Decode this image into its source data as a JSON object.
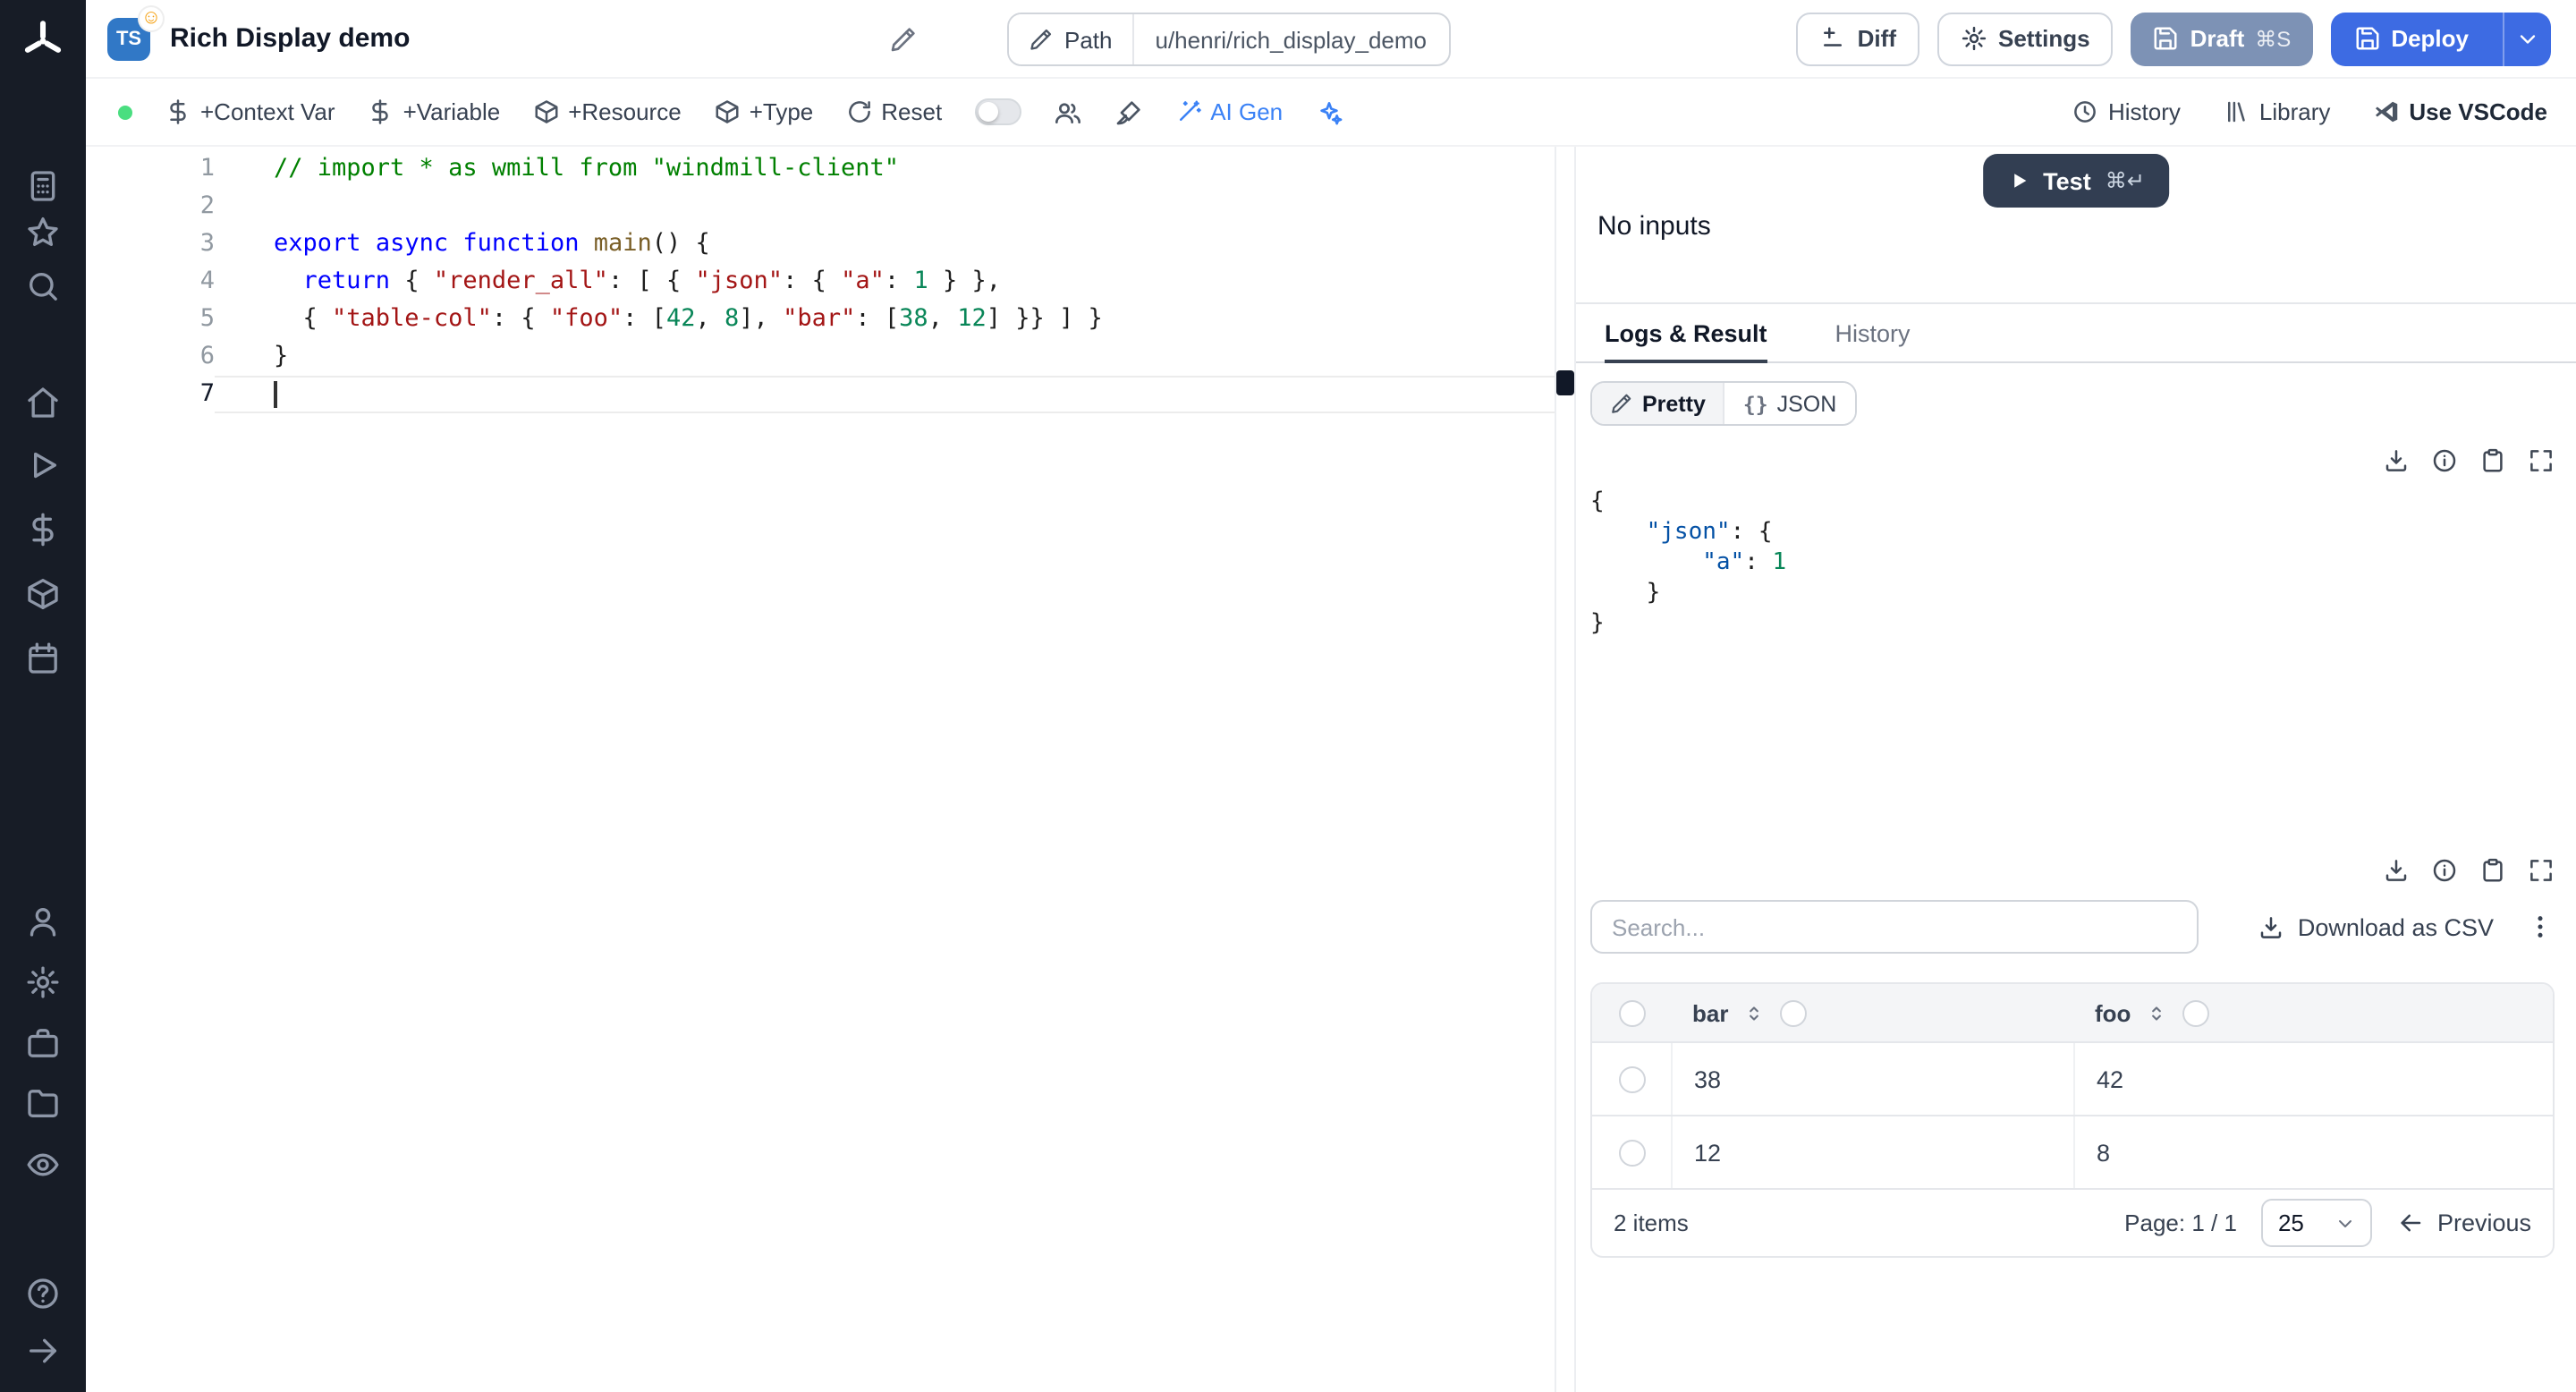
{
  "topbar": {
    "lang_badge": "TS",
    "title": "Rich Display demo",
    "path_label": "Path",
    "path_value": "u/henri/rich_display_demo",
    "diff": "Diff",
    "settings": "Settings",
    "draft": "Draft",
    "draft_kbd": "⌘S",
    "deploy": "Deploy"
  },
  "toolbar": {
    "context_var": "+Context Var",
    "variable": "+Variable",
    "resource": "+Resource",
    "type": "+Type",
    "reset": "Reset",
    "ai_gen": "AI Gen",
    "history": "History",
    "library": "Library",
    "vscode": "Use VSCode"
  },
  "editor": {
    "cursor_line": 7,
    "lines": [
      {
        "n": 1,
        "segs": [
          {
            "c": "comment",
            "t": "// import * as wmill from \"windmill-client\""
          }
        ]
      },
      {
        "n": 2,
        "segs": []
      },
      {
        "n": 3,
        "segs": [
          {
            "c": "kw",
            "t": "export"
          },
          {
            "c": "plain",
            "t": " "
          },
          {
            "c": "kw",
            "t": "async"
          },
          {
            "c": "plain",
            "t": " "
          },
          {
            "c": "kw",
            "t": "function"
          },
          {
            "c": "plain",
            "t": " "
          },
          {
            "c": "fn",
            "t": "main"
          },
          {
            "c": "plain",
            "t": "() {"
          }
        ]
      },
      {
        "n": 4,
        "segs": [
          {
            "c": "plain",
            "t": "  "
          },
          {
            "c": "kw",
            "t": "return"
          },
          {
            "c": "plain",
            "t": " { "
          },
          {
            "c": "str",
            "t": "\"render_all\""
          },
          {
            "c": "plain",
            "t": ": [ { "
          },
          {
            "c": "str",
            "t": "\"json\""
          },
          {
            "c": "plain",
            "t": ": { "
          },
          {
            "c": "str",
            "t": "\"a\""
          },
          {
            "c": "plain",
            "t": ": "
          },
          {
            "c": "num",
            "t": "1"
          },
          {
            "c": "plain",
            "t": " } },"
          }
        ]
      },
      {
        "n": 5,
        "segs": [
          {
            "c": "plain",
            "t": "  { "
          },
          {
            "c": "str",
            "t": "\"table-col\""
          },
          {
            "c": "plain",
            "t": ": { "
          },
          {
            "c": "str",
            "t": "\"foo\""
          },
          {
            "c": "plain",
            "t": ": ["
          },
          {
            "c": "num",
            "t": "42"
          },
          {
            "c": "plain",
            "t": ", "
          },
          {
            "c": "num",
            "t": "8"
          },
          {
            "c": "plain",
            "t": "], "
          },
          {
            "c": "str",
            "t": "\"bar\""
          },
          {
            "c": "plain",
            "t": ": ["
          },
          {
            "c": "num",
            "t": "38"
          },
          {
            "c": "plain",
            "t": ", "
          },
          {
            "c": "num",
            "t": "12"
          },
          {
            "c": "plain",
            "t": "] }} ] }"
          }
        ]
      },
      {
        "n": 6,
        "segs": [
          {
            "c": "plain",
            "t": "}"
          }
        ]
      },
      {
        "n": 7,
        "segs": []
      }
    ]
  },
  "panel": {
    "no_inputs": "No inputs",
    "test": "Test",
    "test_kbd": "⌘↵",
    "tab_logs": "Logs & Result",
    "tab_history": "History",
    "pretty": "Pretty",
    "json_label": "JSON",
    "result_lines": [
      [
        {
          "c": "p",
          "t": "{"
        }
      ],
      [
        {
          "c": "p",
          "t": "    "
        },
        {
          "c": "k",
          "t": "\"json\""
        },
        {
          "c": "p",
          "t": ": {"
        }
      ],
      [
        {
          "c": "p",
          "t": "        "
        },
        {
          "c": "k",
          "t": "\"a\""
        },
        {
          "c": "p",
          "t": ": "
        },
        {
          "c": "n",
          "t": "1"
        }
      ],
      [
        {
          "c": "p",
          "t": "    }"
        }
      ],
      [
        {
          "c": "p",
          "t": "}"
        }
      ]
    ],
    "search_placeholder": "Search...",
    "download_csv": "Download as CSV",
    "table": {
      "columns": [
        "bar",
        "foo"
      ],
      "rows": [
        [
          "38",
          "42"
        ],
        [
          "12",
          "8"
        ]
      ],
      "items": "2 items",
      "page": "Page: 1 / 1",
      "page_size": "25",
      "previous": "Previous"
    }
  }
}
